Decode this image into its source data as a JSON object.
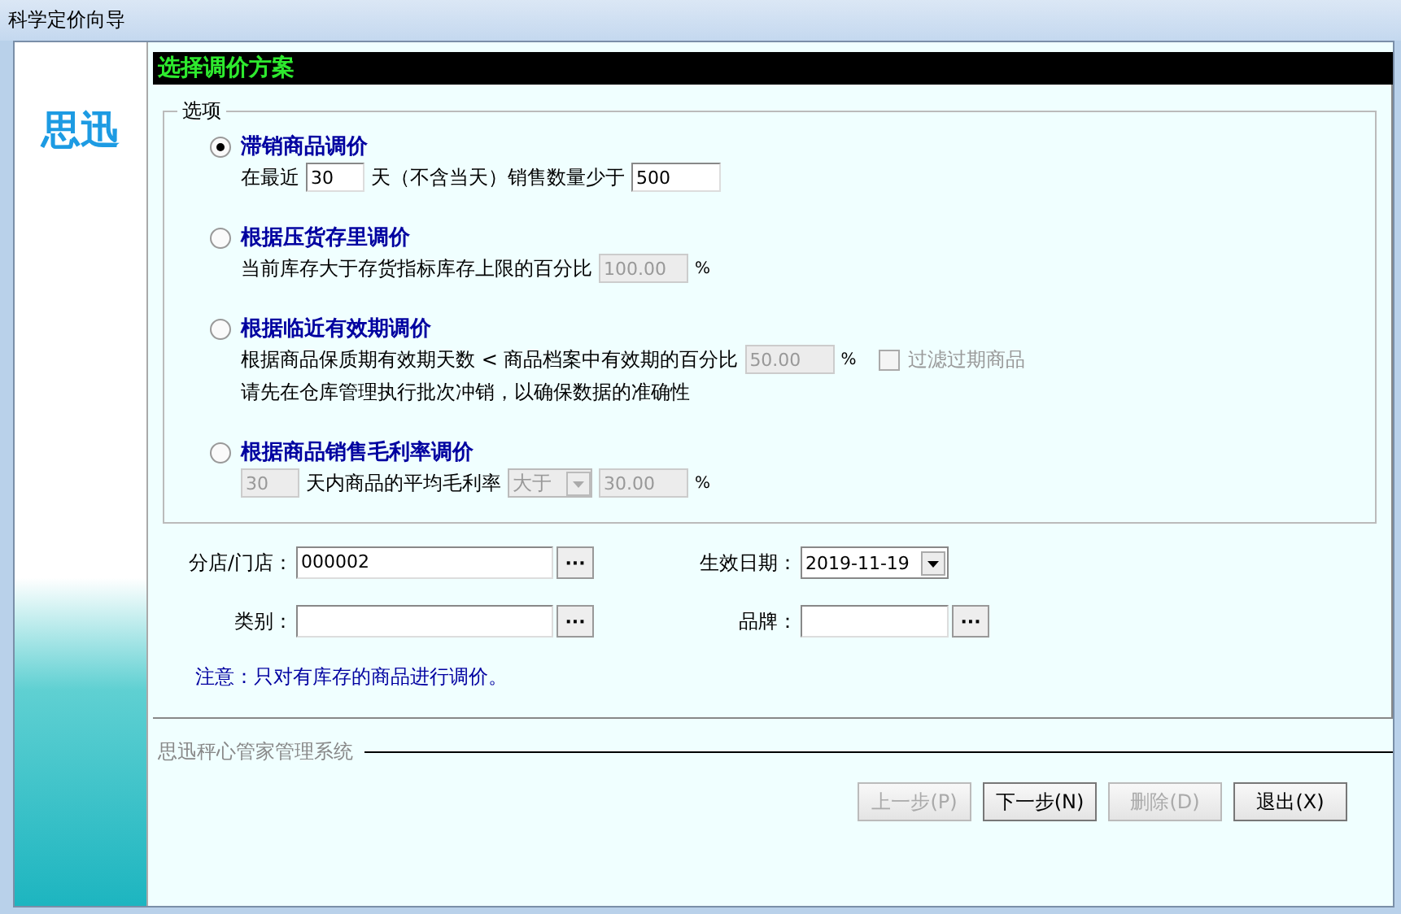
{
  "window": {
    "title": "科学定价向导"
  },
  "logo": {
    "text": "思迅"
  },
  "header": {
    "title": "选择调价方案"
  },
  "options_group": {
    "legend": "选项",
    "options": [
      {
        "label": "滞销商品调价",
        "selected": true,
        "lines": [
          [
            {
              "kind": "text",
              "text": "在最近"
            },
            {
              "kind": "short_input",
              "value": "30",
              "disabled": false
            },
            {
              "kind": "text",
              "text": "天（不含当天）销售数量少于"
            },
            {
              "kind": "input",
              "value": "500",
              "disabled": false
            }
          ]
        ]
      },
      {
        "label": "根据压货存里调价",
        "selected": false,
        "lines": [
          [
            {
              "kind": "text",
              "text": "当前库存大于存货指标库存上限的百分比"
            },
            {
              "kind": "input",
              "value": "100.00",
              "disabled": true
            },
            {
              "kind": "unit",
              "text": "%"
            }
          ]
        ]
      },
      {
        "label": "根据临近有效期调价",
        "selected": false,
        "lines": [
          [
            {
              "kind": "text",
              "text": "根据商品保质期有效期天数 < 商品档案中有效期的百分比"
            },
            {
              "kind": "input",
              "value": "50.00",
              "disabled": true
            },
            {
              "kind": "unit",
              "text": "%"
            },
            {
              "kind": "checkbox",
              "label": "过滤过期商品",
              "checked": false,
              "disabled": true
            }
          ],
          [
            {
              "kind": "text",
              "text": "请先在仓库管理执行批次冲销，以确保数据的准确性"
            }
          ]
        ]
      },
      {
        "label": "根据商品销售毛利率调价",
        "selected": false,
        "lines": [
          [
            {
              "kind": "short_input",
              "value": "30",
              "disabled": true
            },
            {
              "kind": "text",
              "text": "天内商品的平均毛利率"
            },
            {
              "kind": "select",
              "value": "大于",
              "disabled": true
            },
            {
              "kind": "input",
              "value": "30.00",
              "disabled": true
            },
            {
              "kind": "unit",
              "text": "%"
            }
          ]
        ]
      }
    ]
  },
  "form": {
    "rows": [
      [
        {
          "kind": "lookup",
          "label": "分店/门店：",
          "value": "000002",
          "button": "···"
        },
        {
          "kind": "date",
          "label": "生效日期：",
          "value": "2019-11-19"
        }
      ],
      [
        {
          "kind": "lookup",
          "label": "类别：",
          "button": "···"
        },
        {
          "kind": "lookup_short",
          "label": "品牌：",
          "button": "···"
        }
      ]
    ],
    "note": "注意：只对有库存的商品进行调价。"
  },
  "footer": {
    "caption": "思迅秤心管家管理系统"
  },
  "buttons": [
    {
      "label": "上一步(P)",
      "disabled": true
    },
    {
      "label": "下一步(N)",
      "disabled": false
    },
    {
      "label": "删除(D)",
      "disabled": true
    },
    {
      "label": "退出(X)",
      "disabled": false
    }
  ]
}
